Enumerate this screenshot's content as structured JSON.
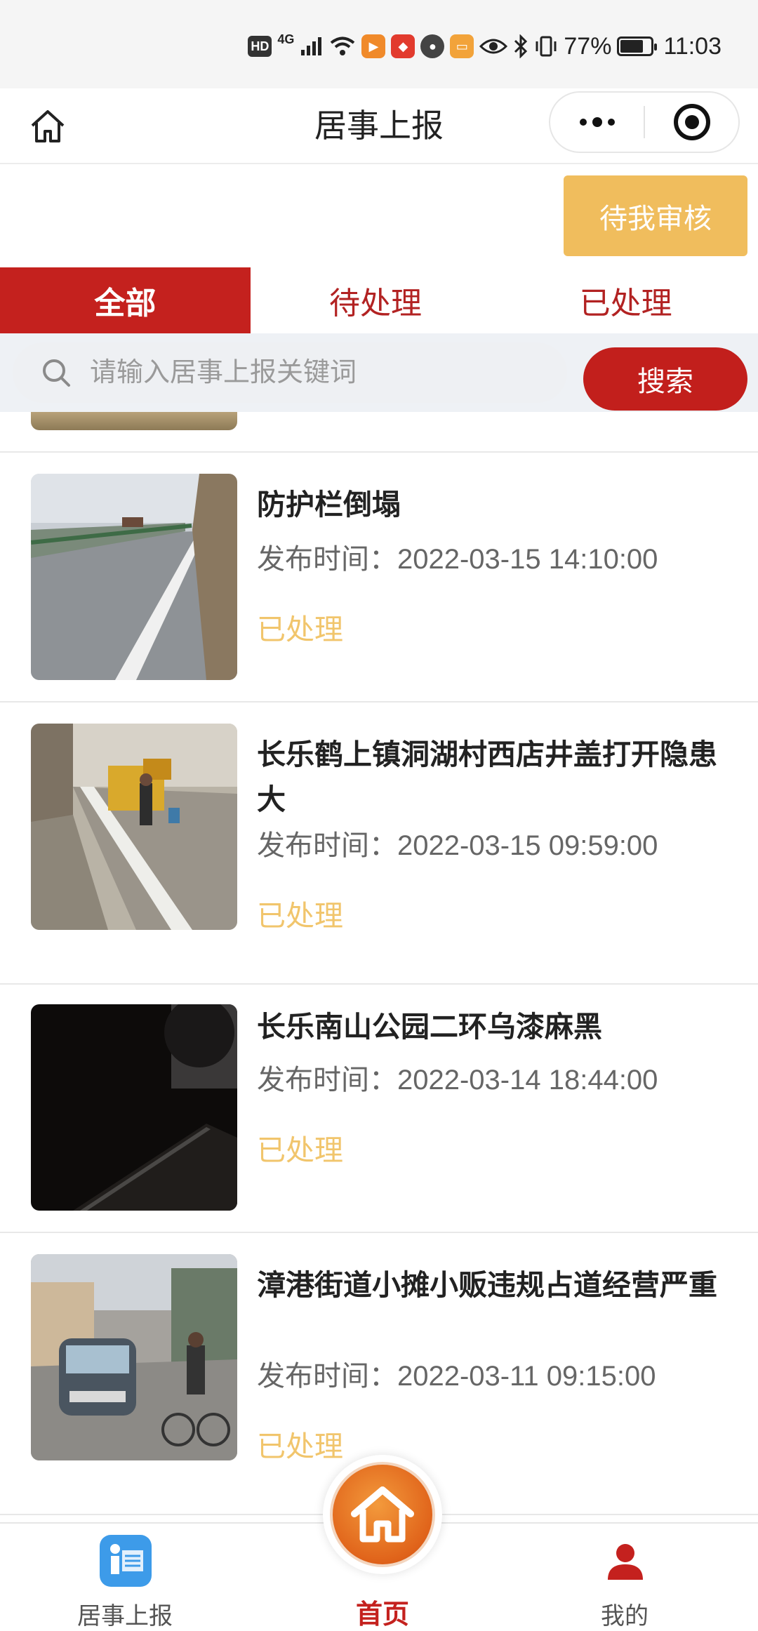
{
  "status_bar": {
    "hd": "HD",
    "network": "4G",
    "battery_percent": "77%",
    "battery_level": 0.77,
    "time": "11:03"
  },
  "nav": {
    "title": "居事上报"
  },
  "review_button": "待我审核",
  "tabs": [
    {
      "label": "全部",
      "active": true
    },
    {
      "label": "待处理",
      "active": false
    },
    {
      "label": "已处理",
      "active": false
    }
  ],
  "search": {
    "placeholder": "请输入居事上报关键词",
    "button": "搜索"
  },
  "items": [
    {
      "title": "防护栏倒塌",
      "time": "发布时间：2022-03-15 14:10:00",
      "status": "已处理"
    },
    {
      "title": "长乐鹤上镇洞湖村西店井盖打开隐患大",
      "time": "发布时间：2022-03-15 09:59:00",
      "status": "已处理"
    },
    {
      "title": "长乐南山公园二环乌漆麻黑",
      "time": "发布时间：2022-03-14 18:44:00",
      "status": "已处理"
    },
    {
      "title": "漳港街道小摊小贩违规占道经营严重",
      "time": "发布时间：2022-03-11 09:15:00",
      "status": "已处理"
    }
  ],
  "tabbar": {
    "left": "居事上报",
    "center": "首页",
    "right": "我的"
  },
  "colors": {
    "primary_red": "#c4211e",
    "review_orange": "#f0bd5d",
    "status_yellow": "#f1c56c",
    "report_icon_blue": "#3d9be9"
  }
}
